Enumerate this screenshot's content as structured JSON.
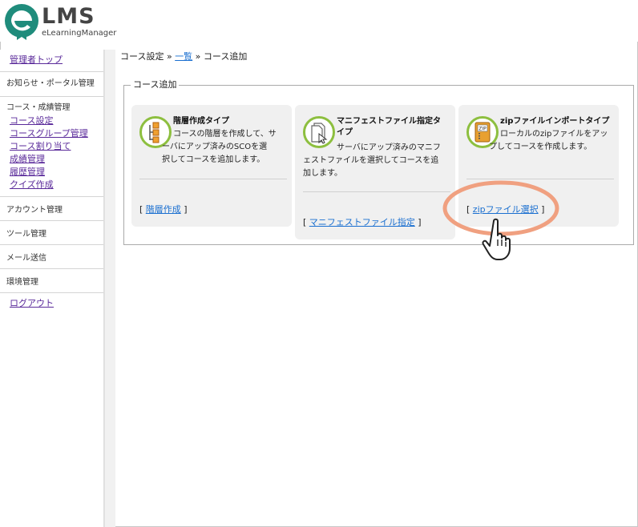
{
  "logo": {
    "text": "LMS",
    "subtitle": "eLearningManager",
    "brand_color": "#1f8c7c"
  },
  "sidebar": {
    "top_link": "管理者トップ",
    "sections": [
      {
        "label": "お知らせ・ポータル管理"
      },
      {
        "label": "コース・成績管理",
        "links": [
          "コース設定",
          "コースグループ管理",
          "コース割り当て",
          "成績管理",
          "履歴管理",
          "クイズ作成"
        ]
      },
      {
        "label": "アカウント管理"
      },
      {
        "label": "ツール管理"
      },
      {
        "label": "メール送信"
      },
      {
        "label": "環境管理"
      }
    ],
    "logout": "ログアウト"
  },
  "breadcrumb": {
    "part1": "コース設定",
    "sep1": " » ",
    "link": "一覧",
    "sep2": " » ",
    "current": "コース追加"
  },
  "panel": {
    "legend": "コース追加",
    "cards": [
      {
        "title": "階層作成タイプ",
        "desc_line1": "コースの階層を作成して、サ",
        "desc_line2": "ーバにアップ済みのSCOを選",
        "desc_line3": "択してコースを追加します。",
        "bracket_open": "[",
        "link": "階層作成",
        "bracket_close": "]",
        "icon": "hierarchy-icon"
      },
      {
        "title_line1": "マニフェストファイル指定タ",
        "title_line2": "イプ",
        "desc_line1": "サーバにアップ済みのマニフ",
        "desc_line2": "ェストファイルを選択してコースを追",
        "desc_line3": "加します。",
        "bracket_open": "[",
        "link": "マニフェストファイル指定",
        "bracket_close": "]",
        "icon": "manifest-file-icon"
      },
      {
        "title": "zipファイルインポートタイプ",
        "desc_line1": "ローカルのzipファイルをアッ",
        "desc_line2": "プしてコースを作成します。",
        "bracket_open": "[",
        "link": "zipファイル選択",
        "bracket_close": "]",
        "icon": "zip-file-icon"
      }
    ]
  },
  "colors": {
    "link_purple": "#5a2a9a",
    "link_blue": "#1a6fd0",
    "icon_ring": "#8dbf3f",
    "highlight": "#f0a080"
  }
}
